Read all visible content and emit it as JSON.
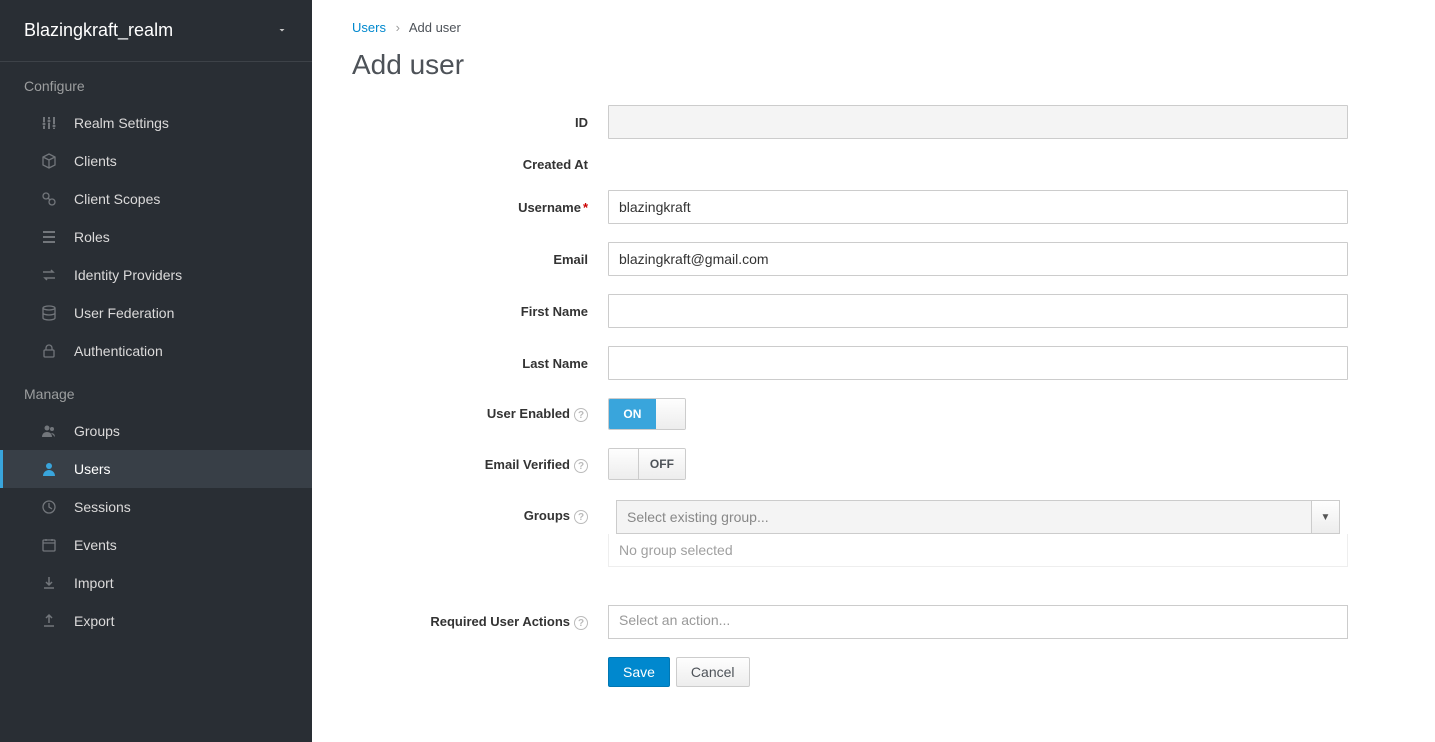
{
  "realm_selector": {
    "name": "Blazingkraft_realm"
  },
  "sidebar": {
    "configure_header": "Configure",
    "manage_header": "Manage",
    "configure": [
      {
        "label": "Realm Settings",
        "icon": "sliders"
      },
      {
        "label": "Clients",
        "icon": "cube"
      },
      {
        "label": "Client Scopes",
        "icon": "scopes"
      },
      {
        "label": "Roles",
        "icon": "list"
      },
      {
        "label": "Identity Providers",
        "icon": "exchange"
      },
      {
        "label": "User Federation",
        "icon": "database"
      },
      {
        "label": "Authentication",
        "icon": "lock"
      }
    ],
    "manage": [
      {
        "label": "Groups",
        "icon": "users"
      },
      {
        "label": "Users",
        "icon": "user",
        "active": true
      },
      {
        "label": "Sessions",
        "icon": "clock"
      },
      {
        "label": "Events",
        "icon": "calendar"
      },
      {
        "label": "Import",
        "icon": "import"
      },
      {
        "label": "Export",
        "icon": "export"
      }
    ]
  },
  "breadcrumb": {
    "parent": "Users",
    "current": "Add user"
  },
  "page": {
    "title": "Add user"
  },
  "form": {
    "id": {
      "label": "ID",
      "value": ""
    },
    "created_at": {
      "label": "Created At",
      "value": ""
    },
    "username": {
      "label": "Username",
      "value": "blazingkraft",
      "required": true
    },
    "email": {
      "label": "Email",
      "value": "blazingkraft@gmail.com"
    },
    "first_name": {
      "label": "First Name",
      "value": ""
    },
    "last_name": {
      "label": "Last Name",
      "value": ""
    },
    "user_enabled": {
      "label": "User Enabled",
      "value": "ON"
    },
    "email_verified": {
      "label": "Email Verified",
      "value": "OFF"
    },
    "groups": {
      "label": "Groups",
      "placeholder": "Select existing group...",
      "help_text": "No group selected"
    },
    "required_actions": {
      "label": "Required User Actions",
      "placeholder": "Select an action..."
    }
  },
  "buttons": {
    "save": "Save",
    "cancel": "Cancel"
  }
}
